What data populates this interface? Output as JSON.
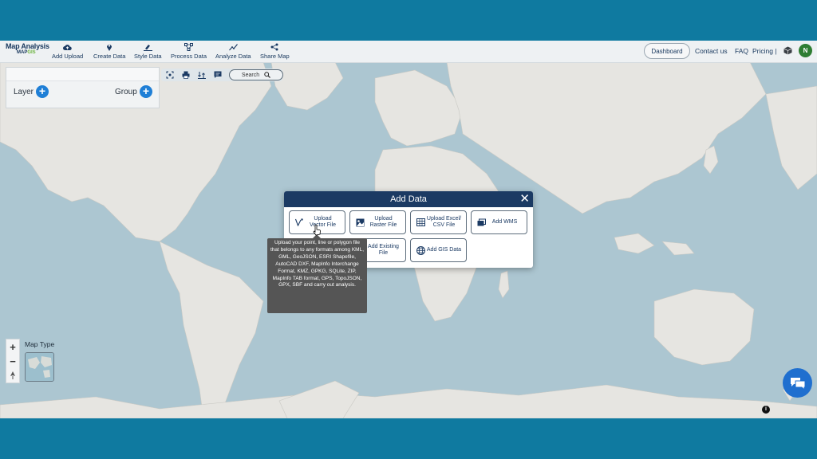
{
  "brand": {
    "title": "Map Analysis",
    "sub_prefix": "MAP",
    "sub_suffix": "GIS"
  },
  "nav": [
    {
      "label": "Add Upload",
      "icon": "cloud-upload-icon"
    },
    {
      "label": "Create Data",
      "icon": "map-pin-icon"
    },
    {
      "label": "Style Data",
      "icon": "paint-brush-icon"
    },
    {
      "label": "Process Data",
      "icon": "process-nodes-icon"
    },
    {
      "label": "Analyze Data",
      "icon": "analyze-chart-icon"
    },
    {
      "label": "Share Map",
      "icon": "share-icon"
    }
  ],
  "header_right": {
    "dashboard": "Dashboard",
    "contact": "Contact us",
    "faq": "FAQ",
    "pricing": "Pricing |",
    "avatar": "N"
  },
  "layer_panel": {
    "layer_label": "Layer",
    "group_label": "Group"
  },
  "toolbar": {
    "search_label": "Search"
  },
  "map_type": {
    "label": "Map Type"
  },
  "zoom": {
    "in": "+",
    "out": "−"
  },
  "modal": {
    "title": "Add Data",
    "close": "✕",
    "options": [
      {
        "line1": "Upload",
        "line2": "Vector File",
        "icon": "vector-icon"
      },
      {
        "line1": "Upload",
        "line2": "Raster File",
        "icon": "raster-image-icon"
      },
      {
        "line1": "Upload Excel/",
        "line2": "CSV File",
        "icon": "spreadsheet-icon"
      },
      {
        "line1": "Add WMS",
        "line2": "",
        "icon": "wms-layers-icon"
      },
      {
        "line1": "Add Existing",
        "line2": "File",
        "icon": "existing-file-icon"
      },
      {
        "line1": "Add GIS Data",
        "line2": "",
        "icon": "globe-icon"
      }
    ]
  },
  "tooltip": {
    "text": "Upload your point, line or polygon file that belongs to any formats among KML, GML, GeoJSON, ESRI Shapefile, AutoCAD DXF, MapInfo Interchange Format, KMZ, GPKG, SQLite, ZIP, MapInfo TAB format, GPS, TopoJSON, GPX, SBF and carry out analysis."
  },
  "colors": {
    "brand_navy": "#1b3a63",
    "accent_blue": "#1f7fd6",
    "ocean": "#acc6d1",
    "land": "#e6e5e1",
    "outer_bg": "#0f7aa0"
  }
}
